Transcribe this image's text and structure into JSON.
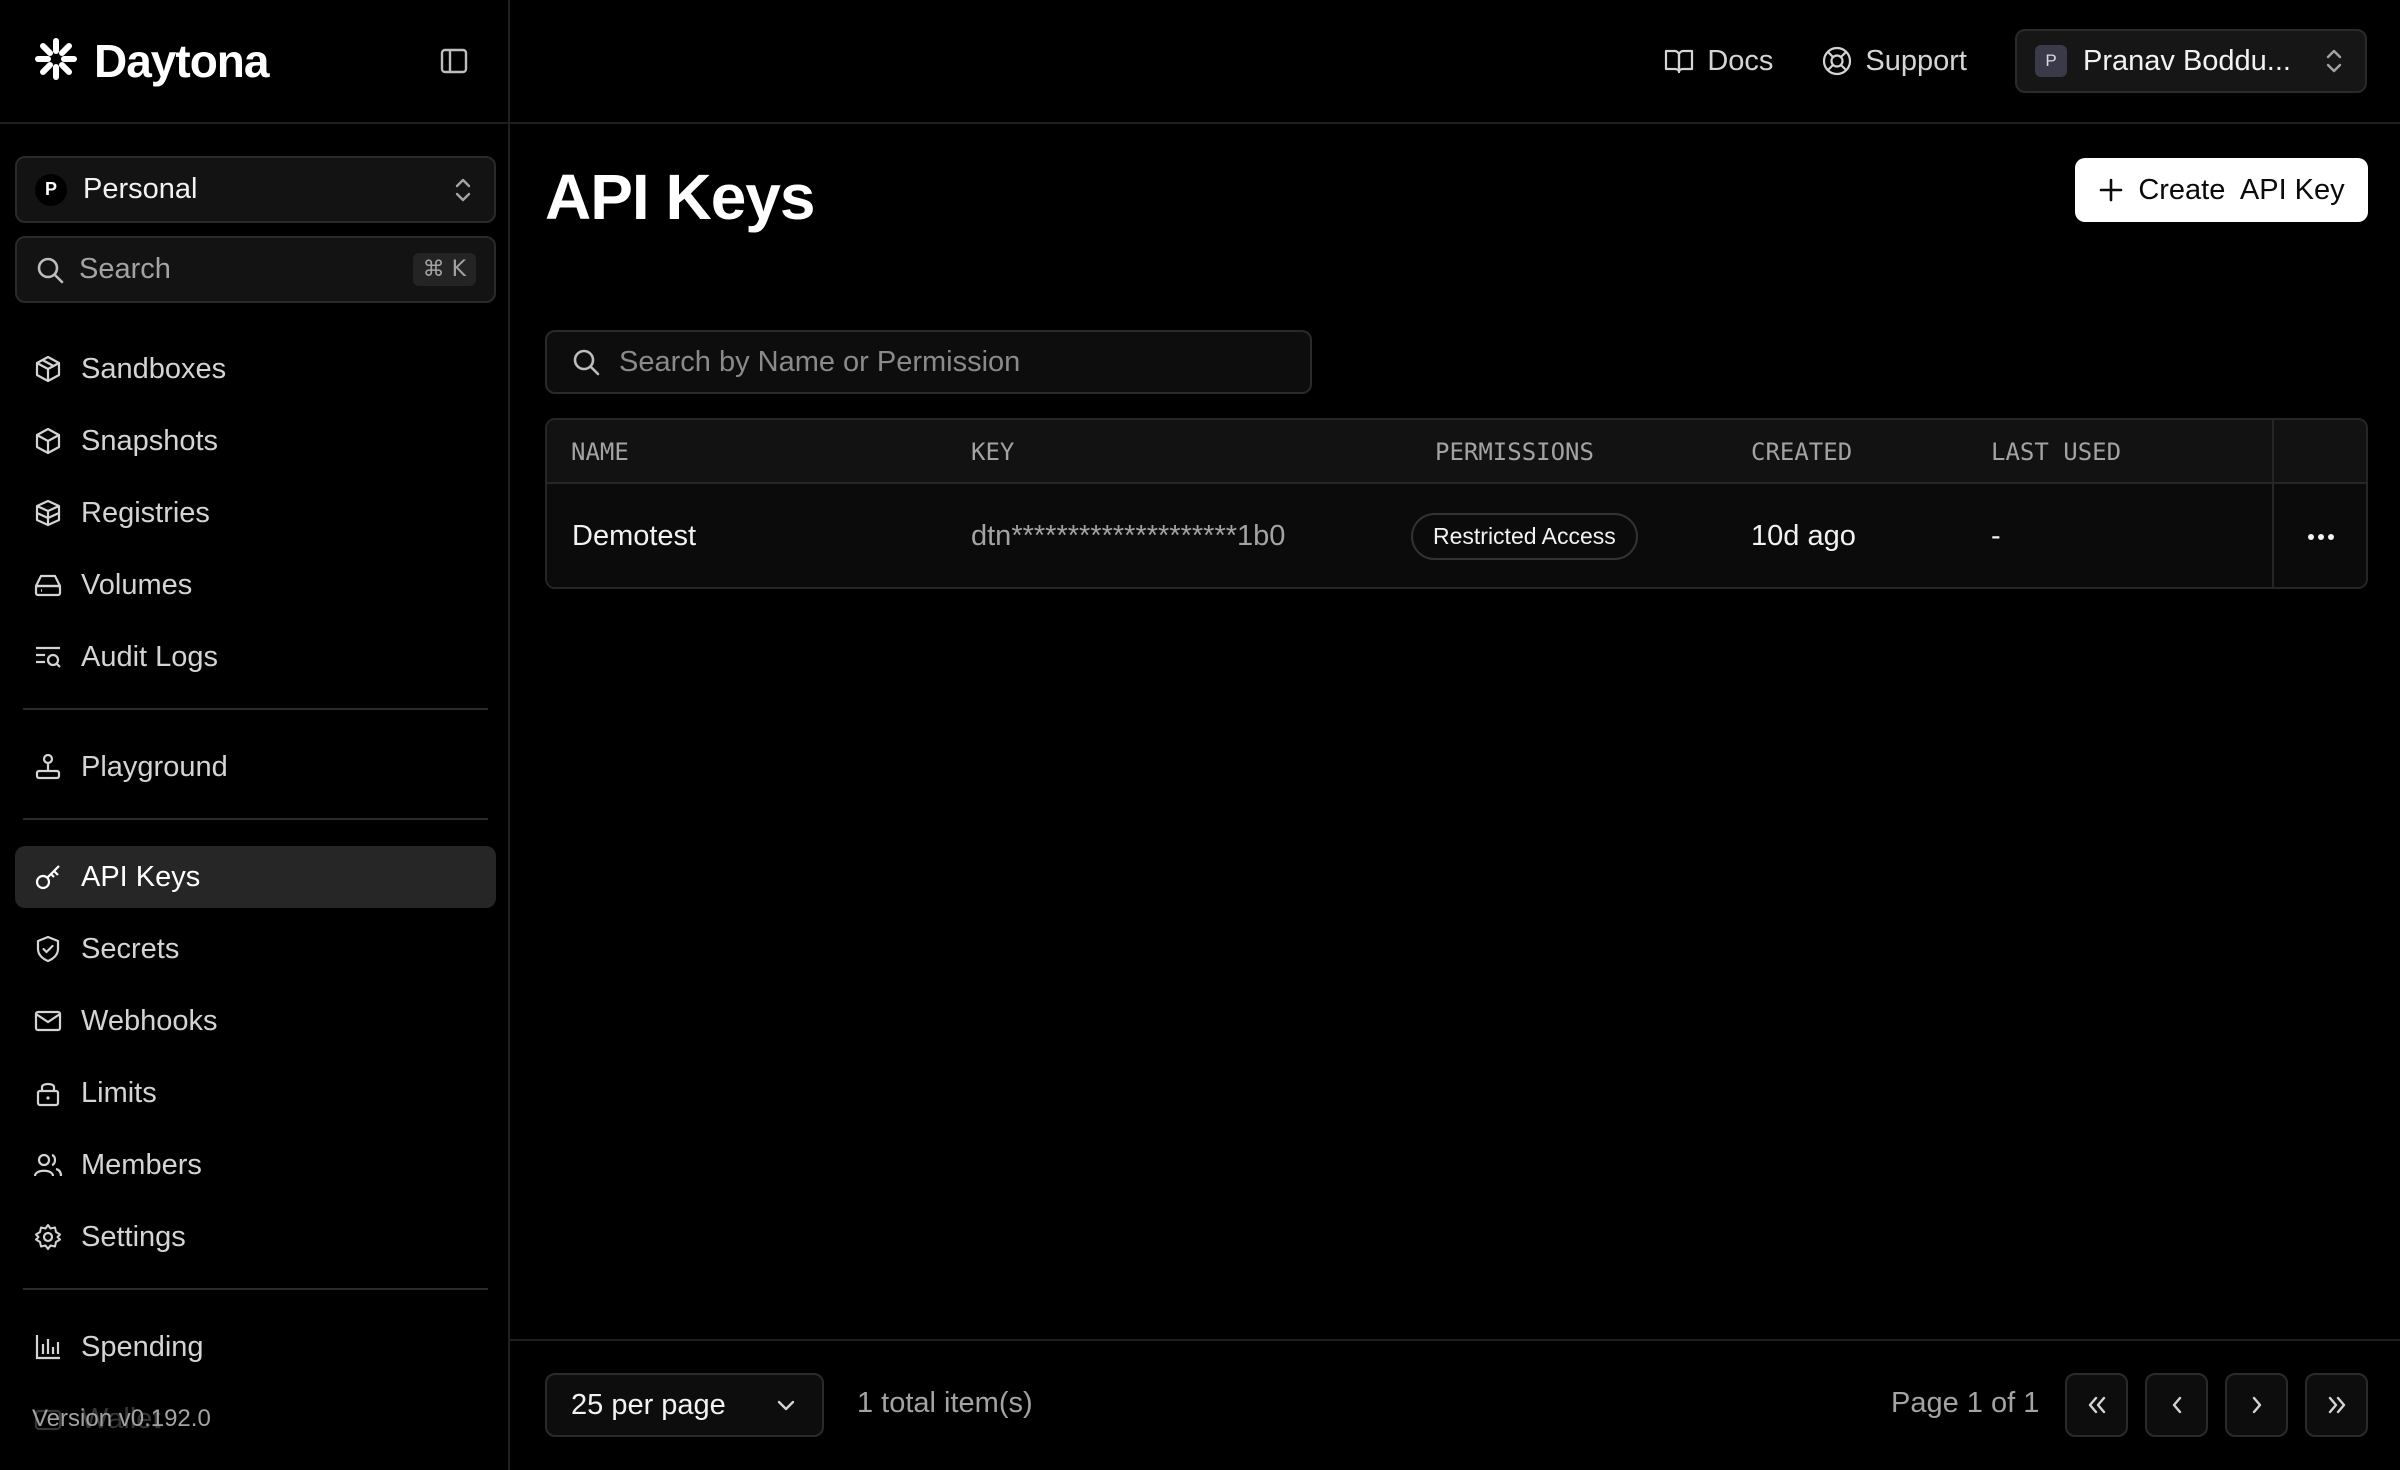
{
  "brand": {
    "name": "Daytona"
  },
  "sidebar": {
    "org": {
      "badge": "P",
      "name": "Personal"
    },
    "search": {
      "label": "Search",
      "shortcut": "⌘ K"
    },
    "items_group1": [
      {
        "label": "Sandboxes",
        "icon": "box-icon"
      },
      {
        "label": "Snapshots",
        "icon": "package-icon"
      },
      {
        "label": "Registries",
        "icon": "packages-icon"
      },
      {
        "label": "Volumes",
        "icon": "hard-drive-icon"
      },
      {
        "label": "Audit Logs",
        "icon": "text-search-icon"
      }
    ],
    "items_group2": [
      {
        "label": "Playground",
        "icon": "joystick-icon"
      }
    ],
    "items_group3": [
      {
        "label": "API Keys",
        "icon": "key-icon",
        "active": true
      },
      {
        "label": "Secrets",
        "icon": "shield-icon"
      },
      {
        "label": "Webhooks",
        "icon": "mail-icon"
      },
      {
        "label": "Limits",
        "icon": "lock-icon"
      },
      {
        "label": "Members",
        "icon": "users-icon"
      },
      {
        "label": "Settings",
        "icon": "gear-icon"
      }
    ],
    "items_group4": [
      {
        "label": "Spending",
        "icon": "bar-chart-icon"
      },
      {
        "label": "Wallet",
        "icon": "wallet-icon"
      }
    ],
    "version": "Version v0.192.0"
  },
  "topbar": {
    "docs": "Docs",
    "support": "Support",
    "user": {
      "badge": "P",
      "name": "Pranav Boddu..."
    }
  },
  "main": {
    "title": "API Keys",
    "create_button": "Create  API Key",
    "search_placeholder": "Search by Name or Permission",
    "columns": [
      "NAME",
      "KEY",
      "PERMISSIONS",
      "CREATED",
      "LAST USED"
    ],
    "rows": [
      {
        "name": "Demotest",
        "key": "dtn********************1b0",
        "permissions": "Restricted Access",
        "created": "10d ago",
        "last_used": "-"
      }
    ]
  },
  "footer": {
    "per_page": "25 per page",
    "total": "1 total item(s)",
    "page_info": "Page 1 of 1"
  },
  "colors": {
    "background": "#000000",
    "active_nav": "#262626",
    "primary_button": "#ffffff"
  }
}
